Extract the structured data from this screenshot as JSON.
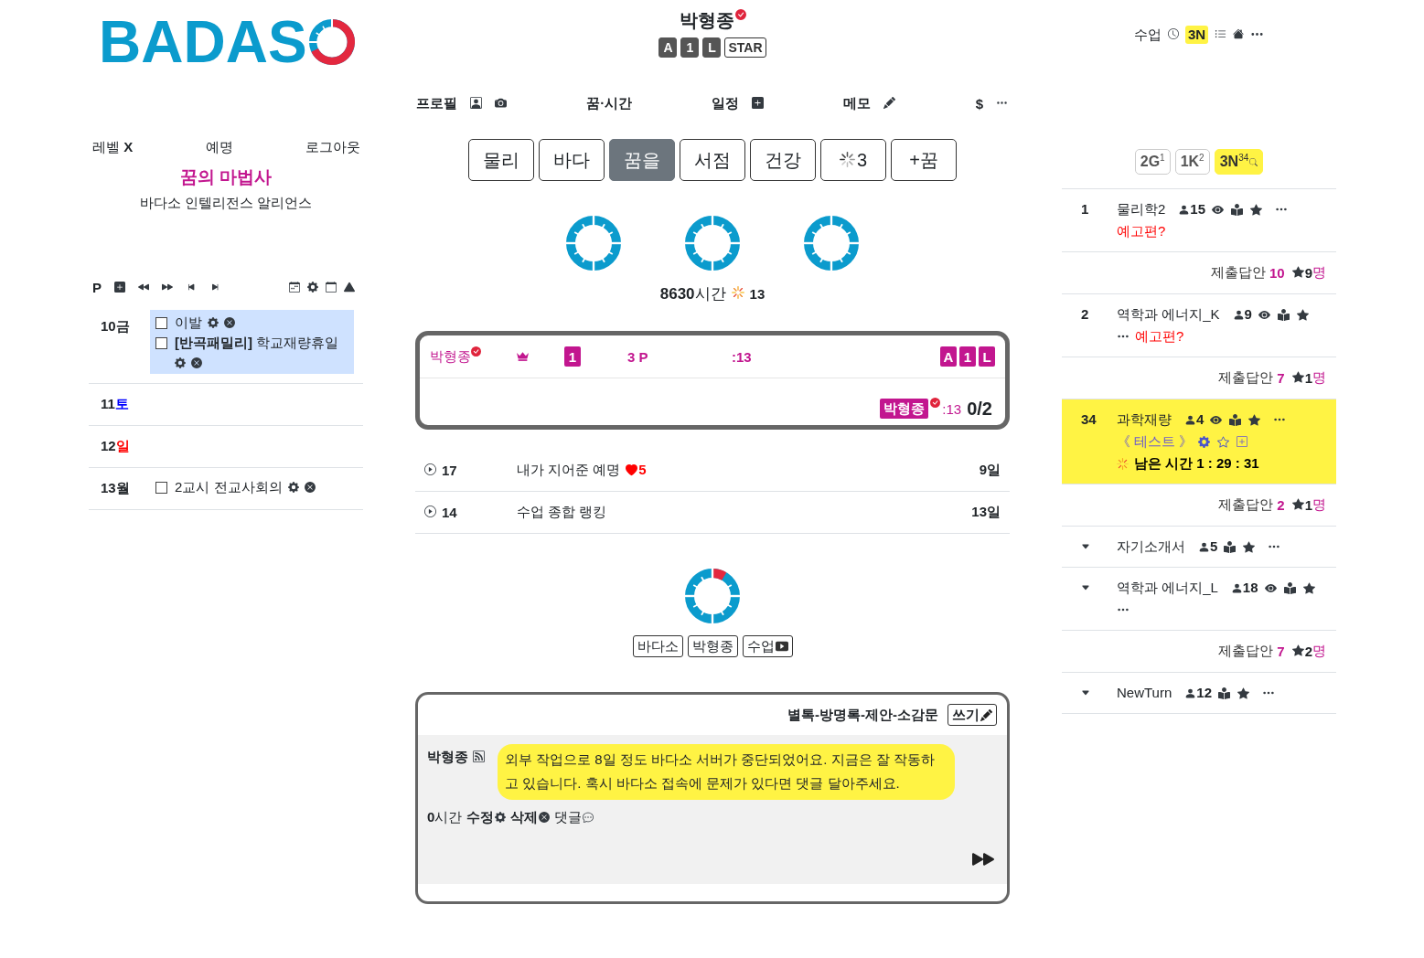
{
  "logo": {
    "text": "BADAS"
  },
  "account": {
    "level": "레벨 **X**",
    "nickname": "예명",
    "logout": "로그아웃"
  },
  "title": "꿈의 마법사",
  "subtitle": "바다소 인텔리전스 알리언스",
  "calendar": {
    "toolbar_label": "P",
    "days": [
      {
        "day": "10",
        "weekday": "금",
        "color": "#212529",
        "highlighted": true,
        "events": [
          {
            "title": "이발",
            "checked": false
          },
          {
            "title": "**[반곡패밀리]** 학교재량휴일",
            "checked": false
          }
        ]
      },
      {
        "day": "11",
        "weekday": "토",
        "color": "#0000ff",
        "highlighted": false
      },
      {
        "day": "12",
        "weekday": "일",
        "color": "#ff0000",
        "highlighted": false
      },
      {
        "day": "13",
        "weekday": "월",
        "color": "#212529",
        "highlighted": false,
        "events": [
          {
            "title": "2교시 전교사회의",
            "checked": false
          }
        ]
      }
    ]
  },
  "profile": {
    "name": "박형종",
    "badges": [
      {
        "label": "A",
        "kind": "filled"
      },
      {
        "label": "1",
        "kind": "filled"
      },
      {
        "label": "L",
        "kind": "filled"
      },
      {
        "label": "STAR",
        "kind": "outline"
      }
    ]
  },
  "nav": [
    {
      "label": "프로필",
      "kind": "profile"
    },
    {
      "label": "꿈·시간",
      "kind": "plain"
    },
    {
      "label": "일정",
      "kind": "add"
    },
    {
      "label": "메모",
      "kind": "edit"
    },
    {
      "label": "$",
      "kind": "more"
    }
  ],
  "tabs": [
    {
      "label": "물리",
      "selected": false,
      "kind": "text"
    },
    {
      "label": "바다",
      "selected": false,
      "kind": "text"
    },
    {
      "label": "꿈을",
      "selected": true,
      "kind": "text"
    },
    {
      "label": "서점",
      "selected": false,
      "kind": "text"
    },
    {
      "label": "건강",
      "selected": false,
      "kind": "text"
    },
    {
      "label": "3",
      "selected": false,
      "kind": "loading"
    },
    {
      "label": "+꿈",
      "selected": false,
      "kind": "text"
    }
  ],
  "stats": {
    "hours": "**8630**시간",
    "count": "13"
  },
  "score_card": {
    "player": "박형종",
    "rank": "1",
    "points": "3 P",
    "time": ":13",
    "badges": [
      "A",
      "1",
      "L"
    ],
    "winner": "박형종",
    "winner_time": ":13",
    "score": "0/2"
  },
  "features": [
    {
      "number": "17",
      "title": "내가 지어준 예명",
      "likes": "5",
      "days": "9일"
    },
    {
      "number": "14",
      "title": "수업 종합 랭킹",
      "days": "13일"
    }
  ],
  "links": [
    {
      "label": "바다소",
      "kind": "plain"
    },
    {
      "label": "박형종",
      "kind": "plain"
    },
    {
      "label": "수업",
      "kind": "video"
    }
  ],
  "board": {
    "title": "별톡-방명록-제안-소감문",
    "write": "쓰기",
    "posts": [
      {
        "author": "박형종",
        "message": "외부 작업으로 8일 정도 바다소 서버가 중단되었어요. 지금은 잘 작동하고 있습니다. 혹시 바다소 접속에 문제가 있다면 댓글 달아주세요.",
        "time": "**0**시간",
        "actions": [
          {
            "label": "수정",
            "kind": "edit"
          },
          {
            "label": "삭제",
            "kind": "delete"
          },
          {
            "label": "댓글",
            "kind": "comment"
          }
        ]
      }
    ]
  },
  "class_header": {
    "label": "수업",
    "grade": "3N"
  },
  "grade_filters": [
    {
      "label": "2G$^{1}$",
      "selected": false
    },
    {
      "label": "1K$^{2}$",
      "selected": false
    },
    {
      "label": "3N$^{34}$",
      "selected": true
    }
  ],
  "lessons": [
    {
      "number": "1",
      "title": "물리학2",
      "members": "15",
      "viewable": true,
      "preview": "예고편?",
      "selected": false,
      "submissions": {
        "label": "제출답안",
        "count": "10",
        "starred": "9",
        "unit": "명"
      }
    },
    {
      "number": "2",
      "title": "역학과 에너지_K",
      "members": "9",
      "viewable": true,
      "preview": "예고편?",
      "selected": false,
      "submissions": {
        "label": "제출답안",
        "count": "7",
        "starred": "1",
        "unit": "명"
      }
    },
    {
      "number": "34",
      "title": "과학재량",
      "members": "4",
      "viewable": true,
      "selected": true,
      "tag": "《 테스트 》",
      "remaining": "남은 시간 1 : 29 : 31",
      "submissions": {
        "label": "제출답안",
        "count": "2",
        "starred": "1",
        "unit": "명"
      }
    },
    {
      "title": "자기소개서",
      "members": "5",
      "viewable": false,
      "selected": false
    },
    {
      "title": "역학과 에너지_L",
      "members": "18",
      "viewable": true,
      "selected": false,
      "submissions": {
        "label": "제출답안",
        "count": "7",
        "starred": "2",
        "unit": "명"
      }
    },
    {
      "title": "NewTurn",
      "members": "12",
      "viewable": false,
      "selected": false
    }
  ]
}
